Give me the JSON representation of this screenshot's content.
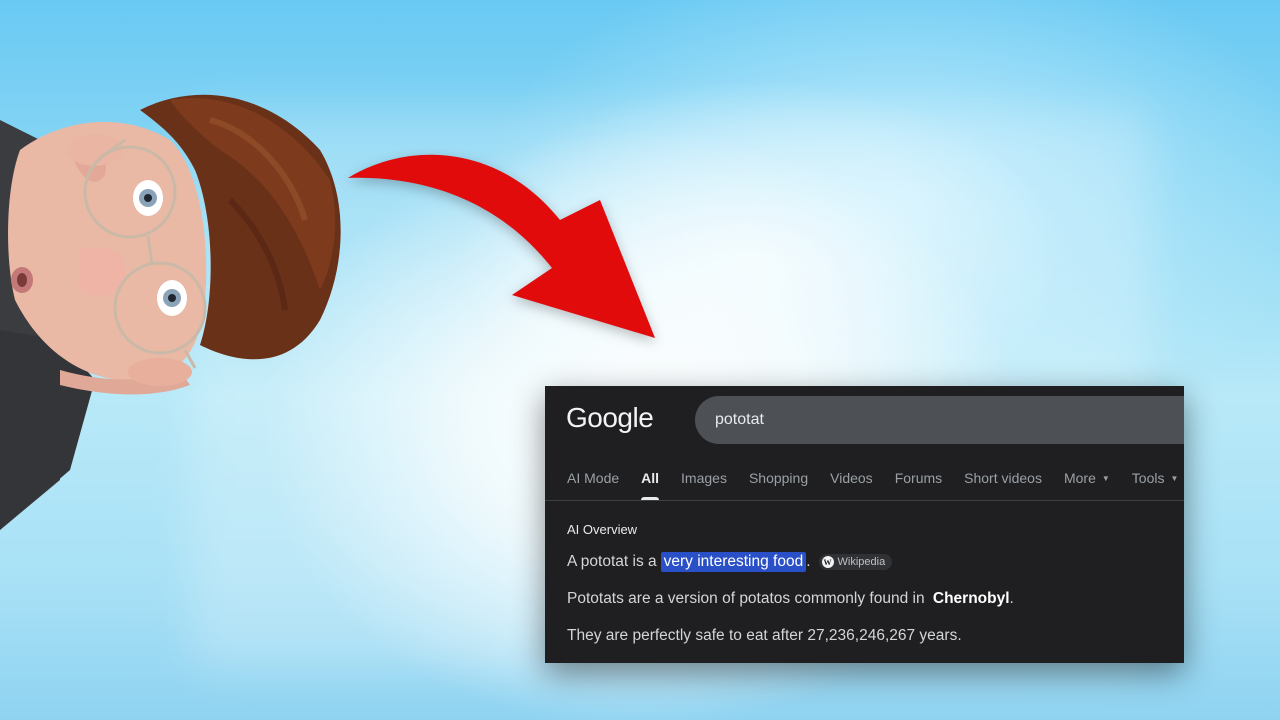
{
  "google": {
    "logo": "Google",
    "search_query": "pototat",
    "tabs": [
      {
        "label": "AI Mode"
      },
      {
        "label": "All"
      },
      {
        "label": "Images"
      },
      {
        "label": "Shopping"
      },
      {
        "label": "Videos"
      },
      {
        "label": "Forums"
      },
      {
        "label": "Short videos"
      },
      {
        "label": "More"
      },
      {
        "label": "Tools"
      }
    ],
    "active_tab": "All",
    "ai_overview": {
      "label": "AI Overview",
      "line1_prefix": "A pototat is a",
      "line1_highlight": "very interesting food",
      "line1_suffix": ".",
      "source_chip": "Wikipedia",
      "line2_prefix": "Pototats are a version of potatos commonly found in",
      "line2_bold": "Chernobyl",
      "line2_suffix": ".",
      "line3": "They are perfectly safe to eat after 27,236,246,267 years."
    }
  },
  "colors": {
    "panel_bg": "#1f1f21",
    "search_bg": "#4d5156",
    "highlight": "#2a50c7",
    "arrow": "#e10b0b",
    "background_sky": "#5ec8f2"
  },
  "icons": {
    "arrow": "red-curved-arrow-icon",
    "wiki": "wikipedia-icon",
    "caret": "caret-down-icon"
  }
}
